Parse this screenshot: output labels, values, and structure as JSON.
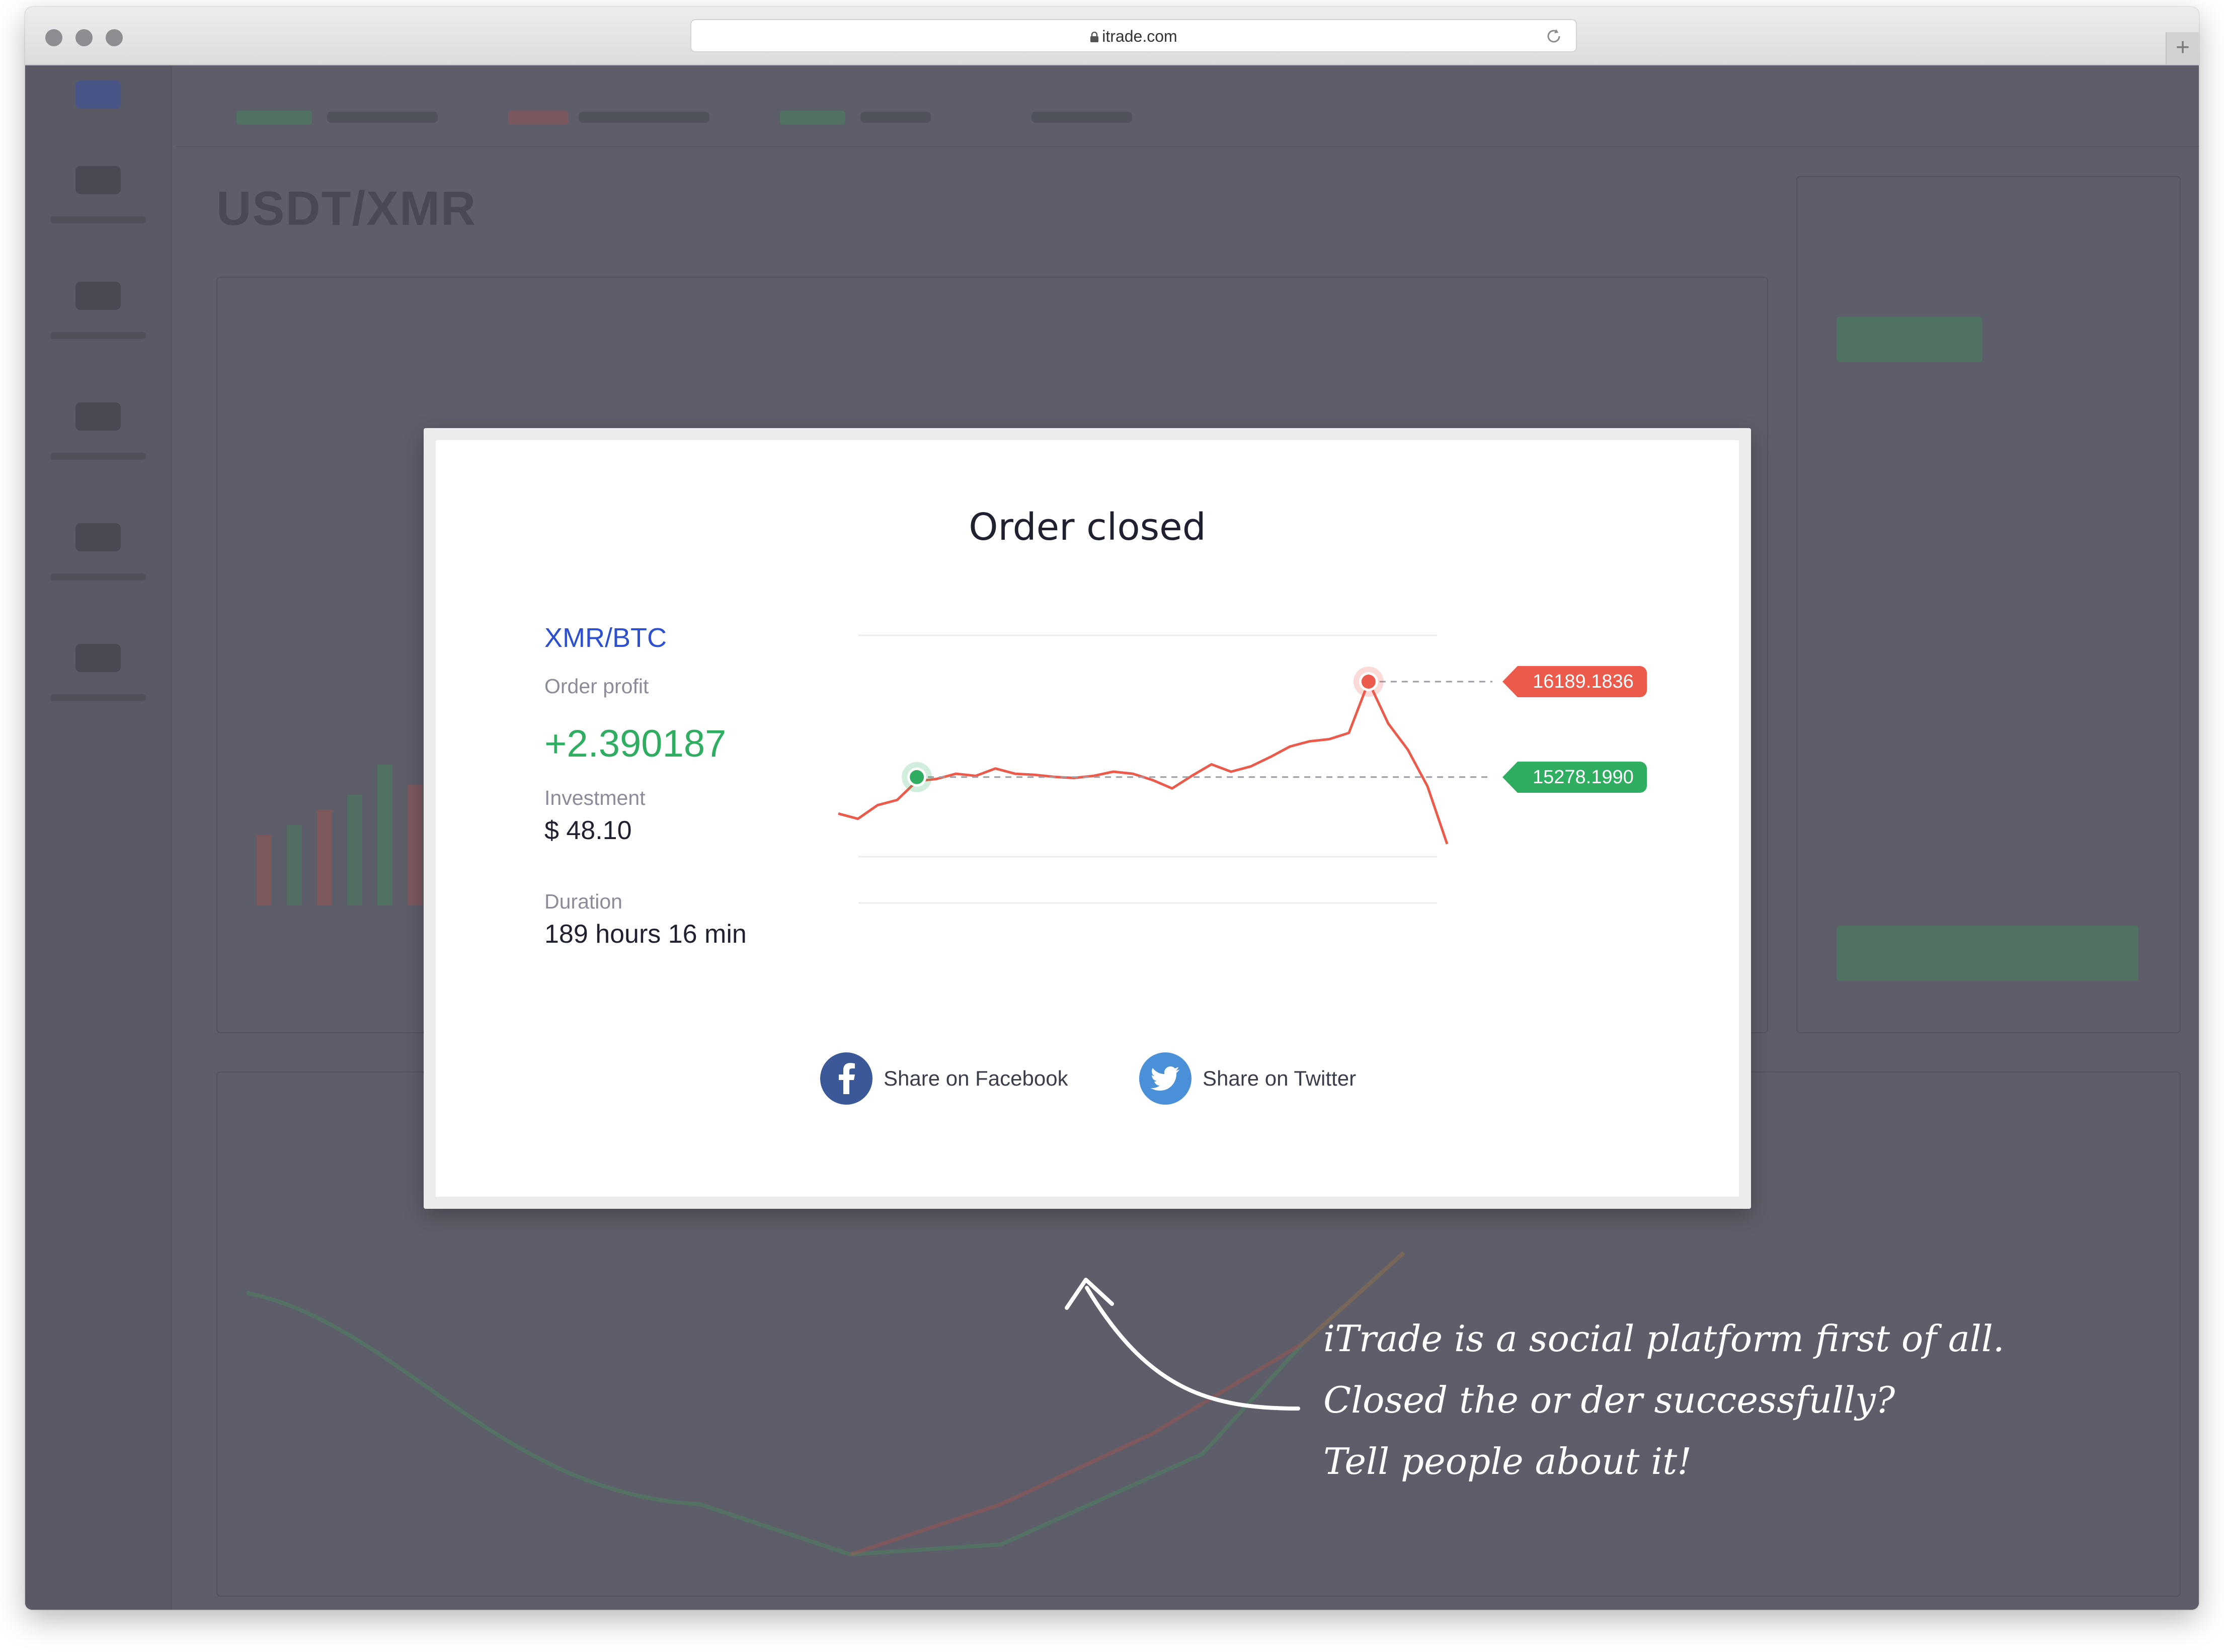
{
  "browser": {
    "url": "itrade.com"
  },
  "background_app": {
    "pair_title": "USDT/XMR"
  },
  "modal": {
    "title": "Order closed",
    "pair": "XMR/BTC",
    "order_profit_label": "Order profit",
    "order_profit_value": "+2.390187",
    "investment_label": "Investment",
    "investment_value": "$ 48.10",
    "duration_label": "Duration",
    "duration_value": "189 hours 16 min",
    "exit_price": "16189.1836",
    "entry_price": "15278.1990",
    "share_facebook": "Share on Facebook",
    "share_twitter": "Share on Twitter"
  },
  "chart_data": {
    "type": "line",
    "title": "",
    "xlabel": "",
    "ylabel": "",
    "series": [
      {
        "values": [
          14930,
          14880,
          15010,
          15060,
          15240,
          15260,
          15310,
          15290,
          15360,
          15310,
          15300,
          15280,
          15270,
          15290,
          15330,
          15310,
          15250,
          15170,
          15290,
          15400,
          15330,
          15380,
          15470,
          15570,
          15620,
          15640,
          15700,
          16189.1836,
          15790,
          15540,
          15190,
          14640
        ]
      }
    ],
    "markers": [
      {
        "type": "entry",
        "value": 15278.199,
        "index": 4
      },
      {
        "type": "exit",
        "value": 16189.1836,
        "index": 27
      }
    ],
    "colors": {
      "line": "#ec5a4c",
      "entry": "#2fae62",
      "exit": "#ec5a4c"
    }
  },
  "annotation": {
    "lines": [
      "iTrade is a social platform first of all.",
      "Closed the or der successfully?",
      "Tell people about it!"
    ]
  },
  "colors": {
    "accent_blue": "#2d4fd1",
    "profit_green": "#2fae62",
    "loss_red": "#ec5a4c",
    "facebook": "#3b5998",
    "twitter": "#4a90d9"
  }
}
